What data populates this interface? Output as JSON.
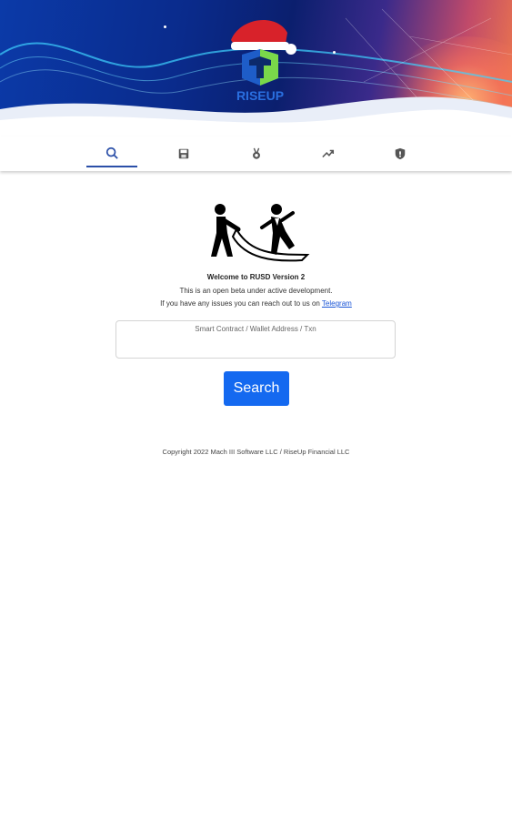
{
  "brand": {
    "logo_text": "RISEUP"
  },
  "tabs": [
    {
      "icon": "search-icon",
      "active": true
    },
    {
      "icon": "save-icon",
      "active": false
    },
    {
      "icon": "award-icon",
      "active": false
    },
    {
      "icon": "trending-icon",
      "active": false
    },
    {
      "icon": "shield-icon",
      "active": false
    }
  ],
  "main": {
    "welcome": "Welcome to RUSD Version 2",
    "beta_note": "This is an open beta under active development.",
    "issues_prefix": "If you have any issues you can reach out to us on ",
    "issues_link": "Telegram"
  },
  "search": {
    "label": "Smart Contract / Wallet Address / Txn",
    "value": "",
    "button_label": "Search"
  },
  "footer": {
    "copyright": "Copyright 2022 Mach III Software LLC / RiseUp Financial LLC"
  },
  "colors": {
    "accent": "#1469f0",
    "tab_active": "#2b4fa8",
    "link": "#1a55d6"
  }
}
